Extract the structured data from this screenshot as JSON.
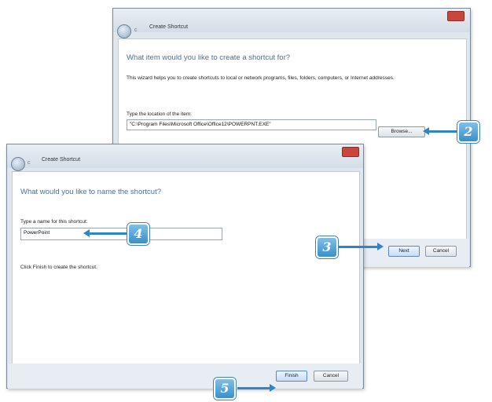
{
  "back_window": {
    "title": "Create Shortcut",
    "heading": "What item would you like to create a shortcut for?",
    "description": "This wizard helps you to create shortcuts to local or network programs, files, folders, computers, or Internet addresses.",
    "location_label": "Type the location of the item:",
    "location_value": "\"C:\\Program Files\\Microsoft Office\\Office12\\POWERPNT.EXE\"",
    "browse_label": "Browse...",
    "next_label": "Next",
    "cancel_label": "Cancel"
  },
  "front_window": {
    "title": "Create Shortcut",
    "heading": "What would you like to name the shortcut?",
    "name_label": "Type a name for this shortcut:",
    "name_value": "PowerPoint",
    "finish_hint": "Click Finish to create the shortcut.",
    "finish_label": "Finish",
    "cancel_label": "Cancel"
  },
  "callouts": {
    "step2": "2",
    "step3": "3",
    "step4": "4",
    "step5": "5"
  },
  "colors": {
    "callout": "#3a8fc9",
    "heading": "#4f6f94",
    "close": "#c8473b"
  }
}
